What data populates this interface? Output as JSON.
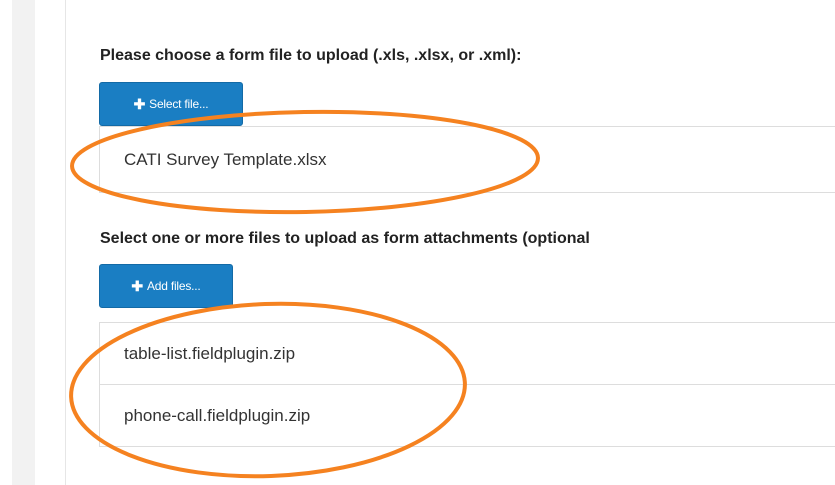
{
  "form_section": {
    "label": "Please choose a form file to upload (.xls, .xlsx, or .xml):",
    "button_label": "Select file...",
    "files": [
      "CATI Survey Template.xlsx"
    ]
  },
  "attachments_section": {
    "label": "Select one or more files to upload as form attachments (optional",
    "button_label": "Add files...",
    "files": [
      "table-list.fieldplugin.zip",
      "phone-call.fieldplugin.zip"
    ]
  },
  "colors": {
    "button": "#1a7ec3",
    "highlight": "#f58220"
  },
  "icons": {
    "button_icon": "plus-icon"
  }
}
